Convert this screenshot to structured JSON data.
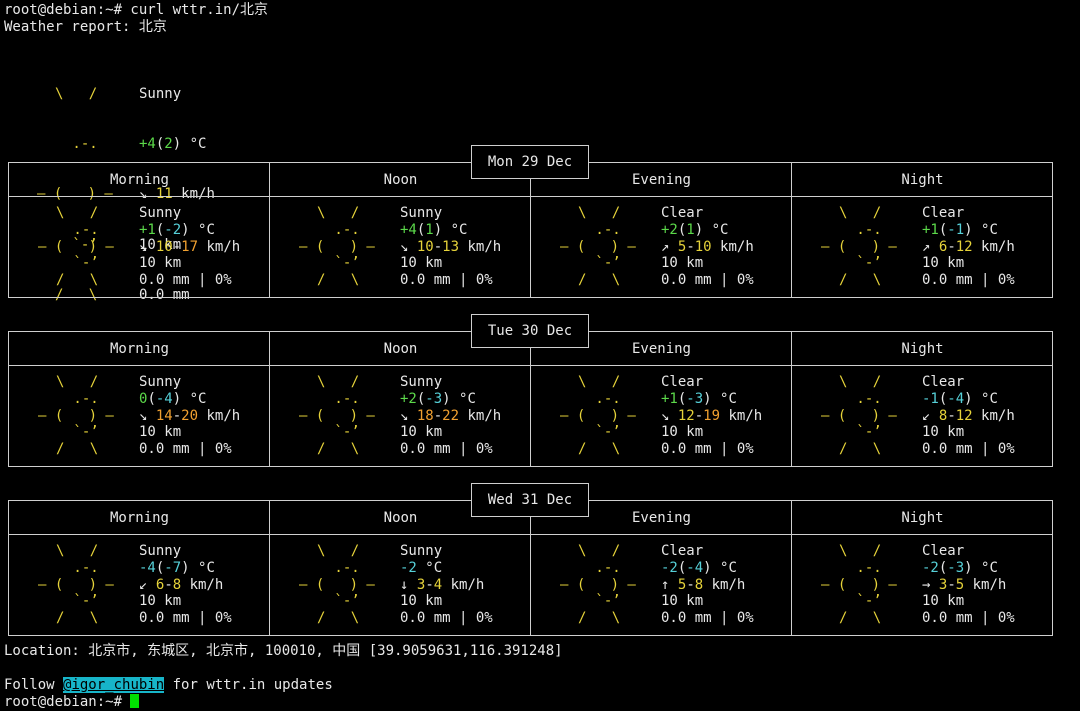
{
  "terminal": {
    "prompt_command": "root@debian:~# curl wttr.in/北京",
    "report_title": "Weather report: 北京",
    "location_line": "Location: 北京市, 东城区, 北京市, 100010, 中国 [39.9059631,116.391248]",
    "follow_prefix": "Follow ",
    "follow_handle": "@igor_chubin",
    "follow_suffix": " for wttr.in updates",
    "partial_prompt": "root@debian:~# "
  },
  "sun_ascii": [
    "\\   /",
    " .-.",
    "― (   ) ―",
    " `-’",
    "/   \\"
  ],
  "current": {
    "condition": "Sunny",
    "temp": "+4",
    "feels": "2",
    "temp_unit": " °C",
    "wind_arrow": "↘",
    "wind": "11",
    "wind_unit": " km/h",
    "visibility": "10 km",
    "precip": "0.0 mm"
  },
  "column_titles": [
    "Morning",
    "Noon",
    "Evening",
    "Night"
  ],
  "days": [
    {
      "date": "Mon 29 Dec",
      "periods": [
        {
          "condition": "Sunny",
          "temp": "+1",
          "feels": "-2",
          "wind_arrow": "↘",
          "wind_lo": "10",
          "wind_hi": "17",
          "visibility": "10 km",
          "precip": "0.0 mm | 0%"
        },
        {
          "condition": "Sunny",
          "temp": "+4",
          "feels": "1",
          "wind_arrow": "↘",
          "wind_lo": "10",
          "wind_hi": "13",
          "visibility": "10 km",
          "precip": "0.0 mm | 0%"
        },
        {
          "condition": "Clear",
          "temp": "+2",
          "feels": "1",
          "wind_arrow": "↗",
          "wind_lo": "5",
          "wind_hi": "10",
          "visibility": "10 km",
          "precip": "0.0 mm | 0%"
        },
        {
          "condition": "Clear",
          "temp": "+1",
          "feels": "-1",
          "wind_arrow": "↗",
          "wind_lo": "6",
          "wind_hi": "12",
          "visibility": "10 km",
          "precip": "0.0 mm | 0%"
        }
      ]
    },
    {
      "date": "Tue 30 Dec",
      "periods": [
        {
          "condition": "Sunny",
          "temp": "0",
          "feels": "-4",
          "wind_arrow": "↘",
          "wind_lo": "14",
          "wind_hi": "20",
          "visibility": "10 km",
          "precip": "0.0 mm | 0%"
        },
        {
          "condition": "Sunny",
          "temp": "+2",
          "feels": "-3",
          "wind_arrow": "↘",
          "wind_lo": "18",
          "wind_hi": "22",
          "visibility": "10 km",
          "precip": "0.0 mm | 0%"
        },
        {
          "condition": "Clear",
          "temp": "+1",
          "feels": "-3",
          "wind_arrow": "↘",
          "wind_lo": "12",
          "wind_hi": "19",
          "visibility": "10 km",
          "precip": "0.0 mm | 0%"
        },
        {
          "condition": "Clear",
          "temp": "-1",
          "feels": "-4",
          "wind_arrow": "↙",
          "wind_lo": "8",
          "wind_hi": "12",
          "visibility": "10 km",
          "precip": "0.0 mm | 0%"
        }
      ]
    },
    {
      "date": "Wed 31 Dec",
      "periods": [
        {
          "condition": "Sunny",
          "temp": "-4",
          "feels": "-7",
          "wind_arrow": "↙",
          "wind_lo": "6",
          "wind_hi": "8",
          "visibility": "10 km",
          "precip": "0.0 mm | 0%"
        },
        {
          "condition": "Sunny",
          "temp": "-2",
          "feels": "",
          "wind_arrow": "↓",
          "wind_lo": "3",
          "wind_hi": "4",
          "visibility": "10 km",
          "precip": "0.0 mm | 0%"
        },
        {
          "condition": "Clear",
          "temp": "-2",
          "feels": "-4",
          "wind_arrow": "↑",
          "wind_lo": "5",
          "wind_hi": "8",
          "visibility": "10 km",
          "precip": "0.0 mm | 0%"
        },
        {
          "condition": "Clear",
          "temp": "-2",
          "feels": "-3",
          "wind_arrow": "→",
          "wind_lo": "3",
          "wind_hi": "5",
          "visibility": "10 km",
          "precip": "0.0 mm | 0%"
        }
      ]
    }
  ],
  "colors": {
    "background": "#000000",
    "text": "#e8e8e8",
    "sun": "#e6d33a",
    "cursor": "#00e000",
    "link_bg": "#17b5c9"
  }
}
